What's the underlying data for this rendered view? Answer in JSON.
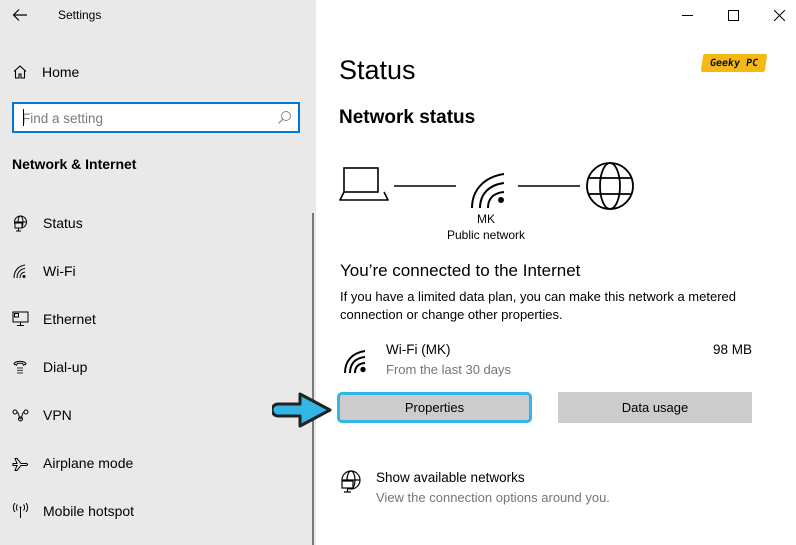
{
  "window": {
    "app_title": "Settings",
    "controls": {
      "minimize": "minimize-icon",
      "maximize": "maximize-icon",
      "close": "close-icon"
    }
  },
  "sidebar": {
    "home_label": "Home",
    "search": {
      "value": "",
      "placeholder": "Find a setting"
    },
    "section_heading": "Network & Internet",
    "items": [
      {
        "label": "Status",
        "icon": "globe-monitor-icon"
      },
      {
        "label": "Wi-Fi",
        "icon": "wifi-icon"
      },
      {
        "label": "Ethernet",
        "icon": "ethernet-icon"
      },
      {
        "label": "Dial-up",
        "icon": "phone-icon"
      },
      {
        "label": "VPN",
        "icon": "vpn-icon"
      },
      {
        "label": "Airplane mode",
        "icon": "airplane-icon"
      },
      {
        "label": "Mobile hotspot",
        "icon": "hotspot-icon"
      }
    ]
  },
  "main": {
    "page_title": "Status",
    "watermark": "Geeky PC",
    "network_status_heading": "Network status",
    "diagram": {
      "network_name": "MK",
      "network_type": "Public network"
    },
    "connected_heading": "You’re connected to the Internet",
    "description": "If you have a limited data plan, you can make this network a metered connection or change other properties.",
    "connection": {
      "name": "Wi-Fi (MK)",
      "period": "From the last 30 days",
      "usage": "98 MB"
    },
    "buttons": {
      "properties": "Properties",
      "data_usage": "Data usage"
    },
    "show_networks": {
      "title": "Show available networks",
      "subtitle": "View the connection options around you."
    },
    "colors": {
      "accent": "#0078d7",
      "highlight": "#33b5e5",
      "watermark_bg": "#f5b915"
    }
  }
}
